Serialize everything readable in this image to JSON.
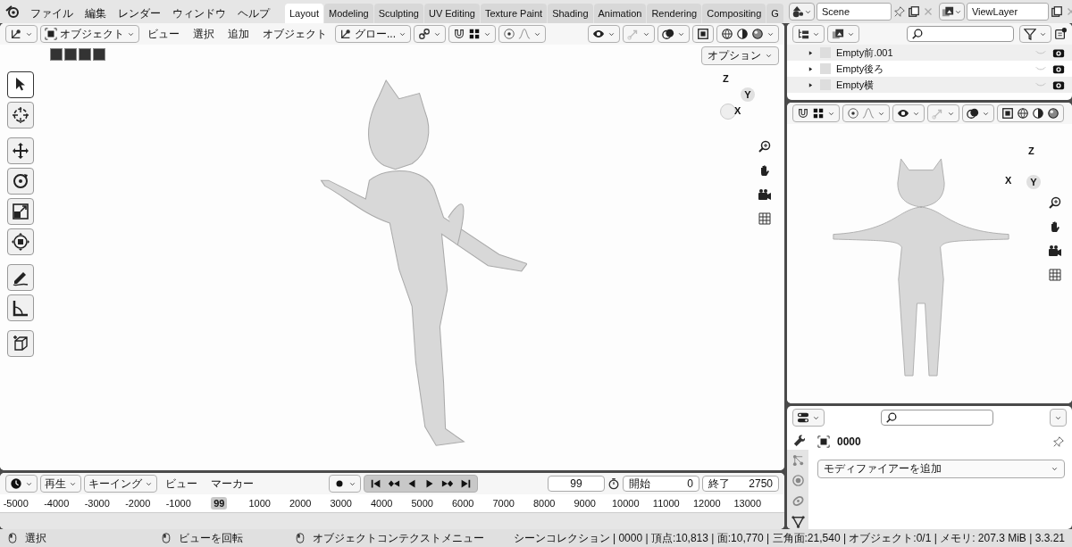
{
  "topbar": {
    "menus": [
      "ファイル",
      "編集",
      "レンダー",
      "ウィンドウ",
      "ヘルプ"
    ],
    "workspaces": [
      {
        "label": "Layout",
        "selected": true
      },
      {
        "label": "Modeling",
        "selected": false
      },
      {
        "label": "Sculpting",
        "selected": false
      },
      {
        "label": "UV Editing",
        "selected": false
      },
      {
        "label": "Texture Paint",
        "selected": false
      },
      {
        "label": "Shading",
        "selected": false
      },
      {
        "label": "Animation",
        "selected": false
      },
      {
        "label": "Rendering",
        "selected": false
      },
      {
        "label": "Compositing",
        "selected": false
      },
      {
        "label": "G",
        "selected": false
      }
    ],
    "scene": "Scene",
    "view_layer": "ViewLayer"
  },
  "viewport": {
    "mode": "オブジェクト",
    "menus": [
      "ビュー",
      "選択",
      "追加",
      "オブジェクト"
    ],
    "orientation": "グロー...",
    "options": "オプション",
    "tools": [
      {
        "kind": "select",
        "selected": true
      },
      {
        "kind": "cursor",
        "selected": false
      },
      {
        "kind": "move",
        "selected": false
      },
      {
        "kind": "rotate",
        "selected": false
      },
      {
        "kind": "scale",
        "selected": false
      },
      {
        "kind": "transform",
        "selected": false
      },
      {
        "kind": "annotate",
        "selected": false
      },
      {
        "kind": "measure",
        "selected": false
      },
      {
        "kind": "add_cube",
        "selected": false
      }
    ],
    "axes": [
      {
        "label": "Z",
        "kind": "text"
      },
      {
        "label": "Y",
        "kind": "ball"
      },
      {
        "label": "X",
        "kind": "text"
      }
    ]
  },
  "outliner": {
    "rows": [
      {
        "name": "Empty前.001"
      },
      {
        "name": "Empty後ろ"
      },
      {
        "name": "Empty横"
      }
    ]
  },
  "side_viewport": {
    "axes": [
      {
        "label": "Z",
        "kind": "text"
      },
      {
        "label": "X",
        "kind": "text"
      },
      {
        "label": "Y",
        "kind": "ball"
      }
    ]
  },
  "properties": {
    "object": "0000",
    "add_modifier": "モディファイアーを追加",
    "tabs": [
      {
        "kind": "wrench",
        "selected": true
      },
      {
        "kind": "particles",
        "selected": false
      },
      {
        "kind": "physics",
        "selected": false
      },
      {
        "kind": "constraint",
        "selected": false
      },
      {
        "kind": "data",
        "selected": false
      }
    ]
  },
  "timeline": {
    "playback": "再生",
    "keying": "キーイング",
    "menus": [
      "ビュー",
      "マーカー"
    ],
    "current_frame": "99",
    "start_label": "開始",
    "start": "0",
    "end_label": "終了",
    "end": "2750",
    "ruler": [
      {
        "label": "-5000",
        "kind": "tick"
      },
      {
        "label": "-4000",
        "kind": "tick"
      },
      {
        "label": "-3000",
        "kind": "tick"
      },
      {
        "label": "-2000",
        "kind": "tick"
      },
      {
        "label": "-1000",
        "kind": "tick"
      },
      {
        "label": "99",
        "kind": "playhead"
      },
      {
        "label": "1000",
        "kind": "tick"
      },
      {
        "label": "2000",
        "kind": "tick"
      },
      {
        "label": "3000",
        "kind": "tick"
      },
      {
        "label": "4000",
        "kind": "tick"
      },
      {
        "label": "5000",
        "kind": "tick"
      },
      {
        "label": "6000",
        "kind": "tick"
      },
      {
        "label": "7000",
        "kind": "tick"
      },
      {
        "label": "8000",
        "kind": "tick"
      },
      {
        "label": "9000",
        "kind": "tick"
      },
      {
        "label": "10000",
        "kind": "tick"
      },
      {
        "label": "11000",
        "kind": "tick"
      },
      {
        "label": "12000",
        "kind": "tick"
      },
      {
        "label": "13000",
        "kind": "tick"
      }
    ]
  },
  "status_bar": {
    "hints": [
      "選択",
      "ビューを回転",
      "オブジェクトコンテクストメニュー"
    ],
    "stats": "シーンコレクション | 0000 | 頂点:10,813 | 面:10,770 | 三角面:21,540 | オブジェクト:0/1 | メモリ: 207.3 MiB | 3.3.21"
  }
}
